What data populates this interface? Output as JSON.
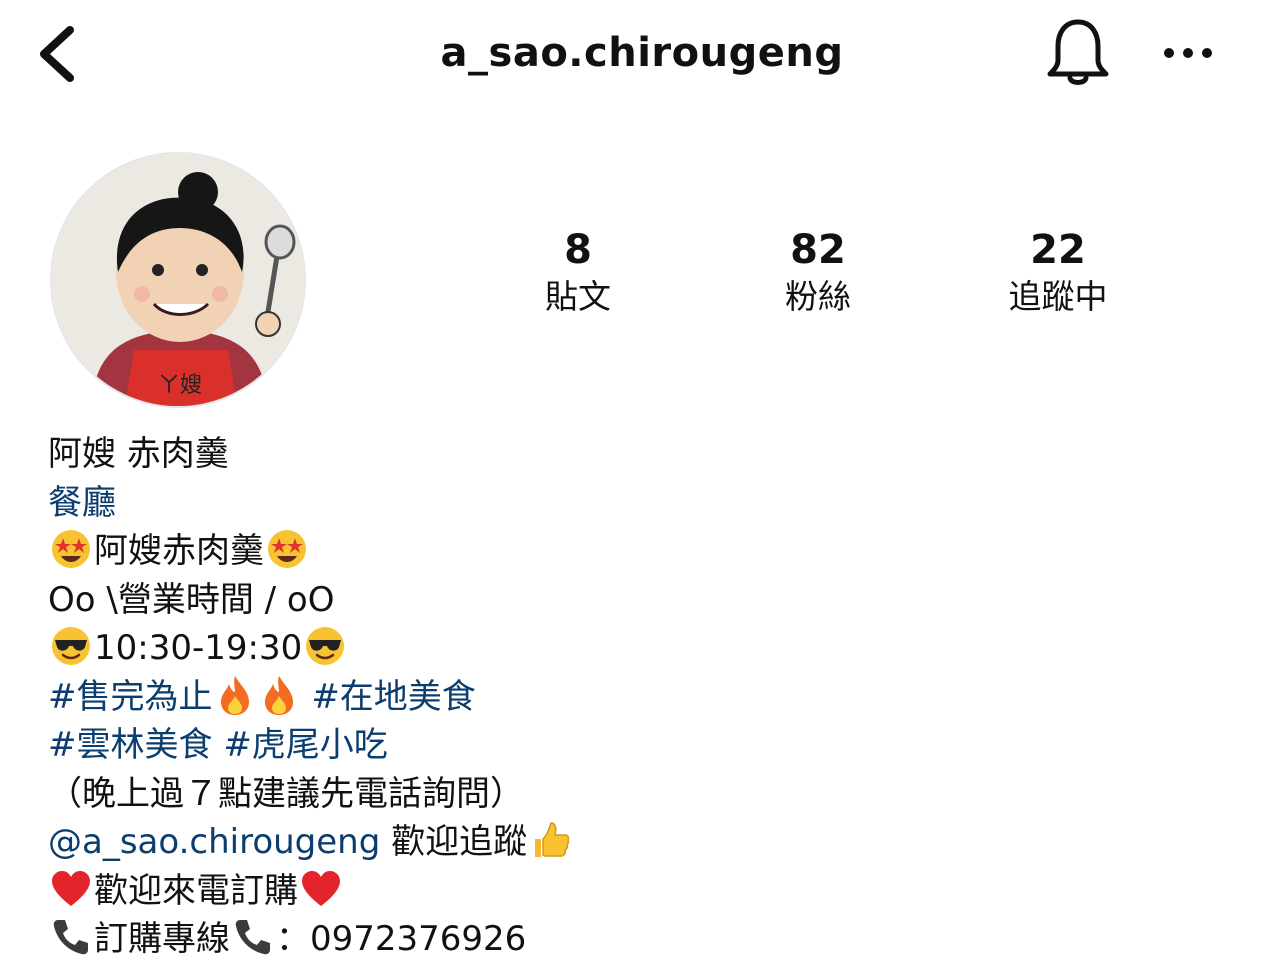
{
  "header": {
    "username": "a_sao.chirougeng",
    "back_icon": "chevron-left-icon",
    "bell_icon": "bell-icon",
    "more_icon": "more-horizontal-icon"
  },
  "profile": {
    "avatar_text": "ㄚ嫂",
    "stats": [
      {
        "value": "8",
        "label": "貼文"
      },
      {
        "value": "82",
        "label": "粉絲"
      },
      {
        "value": "22",
        "label": "追蹤中"
      }
    ]
  },
  "bio": {
    "name": "阿嫂 赤肉羹",
    "category": "餐廳",
    "line1_text": "阿嫂赤肉羹",
    "line2_text": "Oo \\營業時間 / oO",
    "line3_text": "10:30-19:30",
    "tag1": "#售完為止",
    "tag2": "#在地美食",
    "tag3": "#雲林美食",
    "tag4": "#虎尾小吃",
    "note": "（晚上過７點建議先電話詢問）",
    "mention": "@a_sao.chirougeng",
    "mention_suffix": " 歡迎追蹤",
    "order_text": "歡迎來電訂購",
    "phone_label": "訂購專線",
    "phone_number": "：0972376926"
  },
  "colors": {
    "link": "#0b3d6e",
    "text": "#111111",
    "background": "#ffffff"
  }
}
